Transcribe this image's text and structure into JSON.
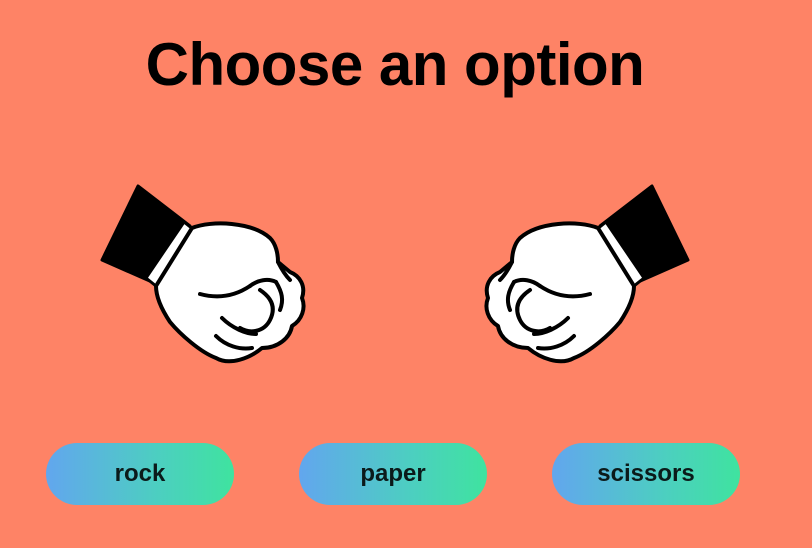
{
  "title": "Choose an option",
  "players": [
    {
      "hand": "fist-icon",
      "facing": "right"
    },
    {
      "hand": "fist-icon",
      "facing": "left"
    }
  ],
  "options": [
    {
      "label": "rock"
    },
    {
      "label": "paper"
    },
    {
      "label": "scissors"
    }
  ],
  "colors": {
    "background": "#fe8366",
    "button_gradient_start": "#62a6ee",
    "button_gradient_end": "#3fe39f"
  }
}
